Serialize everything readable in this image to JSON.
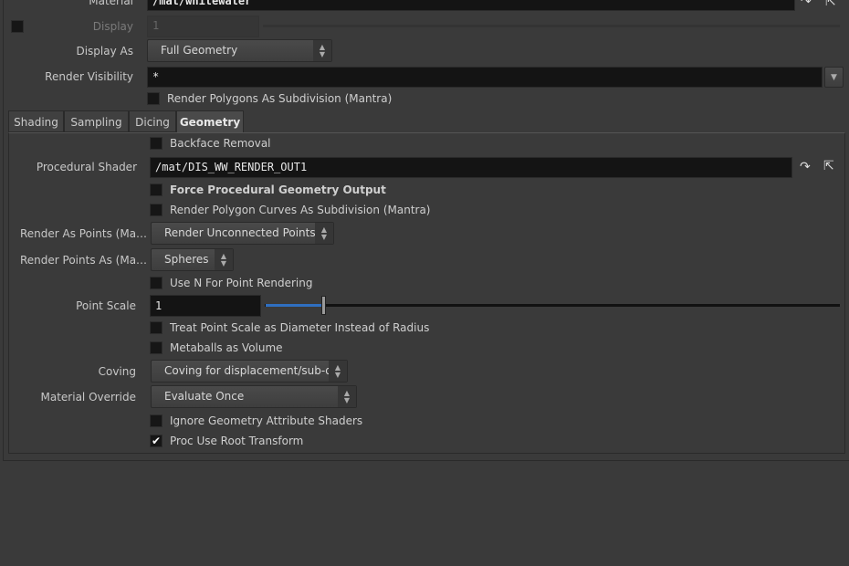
{
  "top": {
    "material_label": "Material",
    "material_value": "/mat/whitewater",
    "display_label": "Display",
    "display_value": "1",
    "display_as_label": "Display As",
    "display_as_value": "Full Geometry",
    "render_visibility_label": "Render Visibility",
    "render_visibility_value": "*",
    "render_polys_subdiv": "Render Polygons As Subdivision (Mantra)"
  },
  "tabs": [
    {
      "label": "Shading"
    },
    {
      "label": "Sampling"
    },
    {
      "label": "Dicing"
    },
    {
      "label": "Geometry"
    }
  ],
  "geometry": {
    "backface": "Backface Removal",
    "proc_shader_label": "Procedural Shader",
    "proc_shader_value": "/mat/DIS_WW_RENDER_OUT1",
    "force_proc": "Force Procedural Geometry Output",
    "render_poly_curves": "Render Polygon Curves As Subdivision (Mantra)",
    "render_as_points_label": "Render As Points (Ma…",
    "render_as_points_value": "Render Unconnected Points",
    "render_points_as_label": "Render Points As (Ma…",
    "render_points_as_value": "Spheres",
    "use_n": "Use N For Point Rendering",
    "point_scale_label": "Point Scale",
    "point_scale_value": "1",
    "treat_diameter": "Treat Point Scale as Diameter Instead of Radius",
    "metaballs": "Metaballs as Volume",
    "coving_label": "Coving",
    "coving_value": "Coving for displacement/sub-d",
    "material_override_label": "Material Override",
    "material_override_value": "Evaluate Once",
    "ignore_geo_shaders": "Ignore Geometry Attribute Shaders",
    "proc_root": "Proc Use Root Transform",
    "check_mark": "✔"
  },
  "colors": {
    "slider_fill": "#2f6fc0",
    "background": "#3a3a3a",
    "field": "#141414"
  }
}
